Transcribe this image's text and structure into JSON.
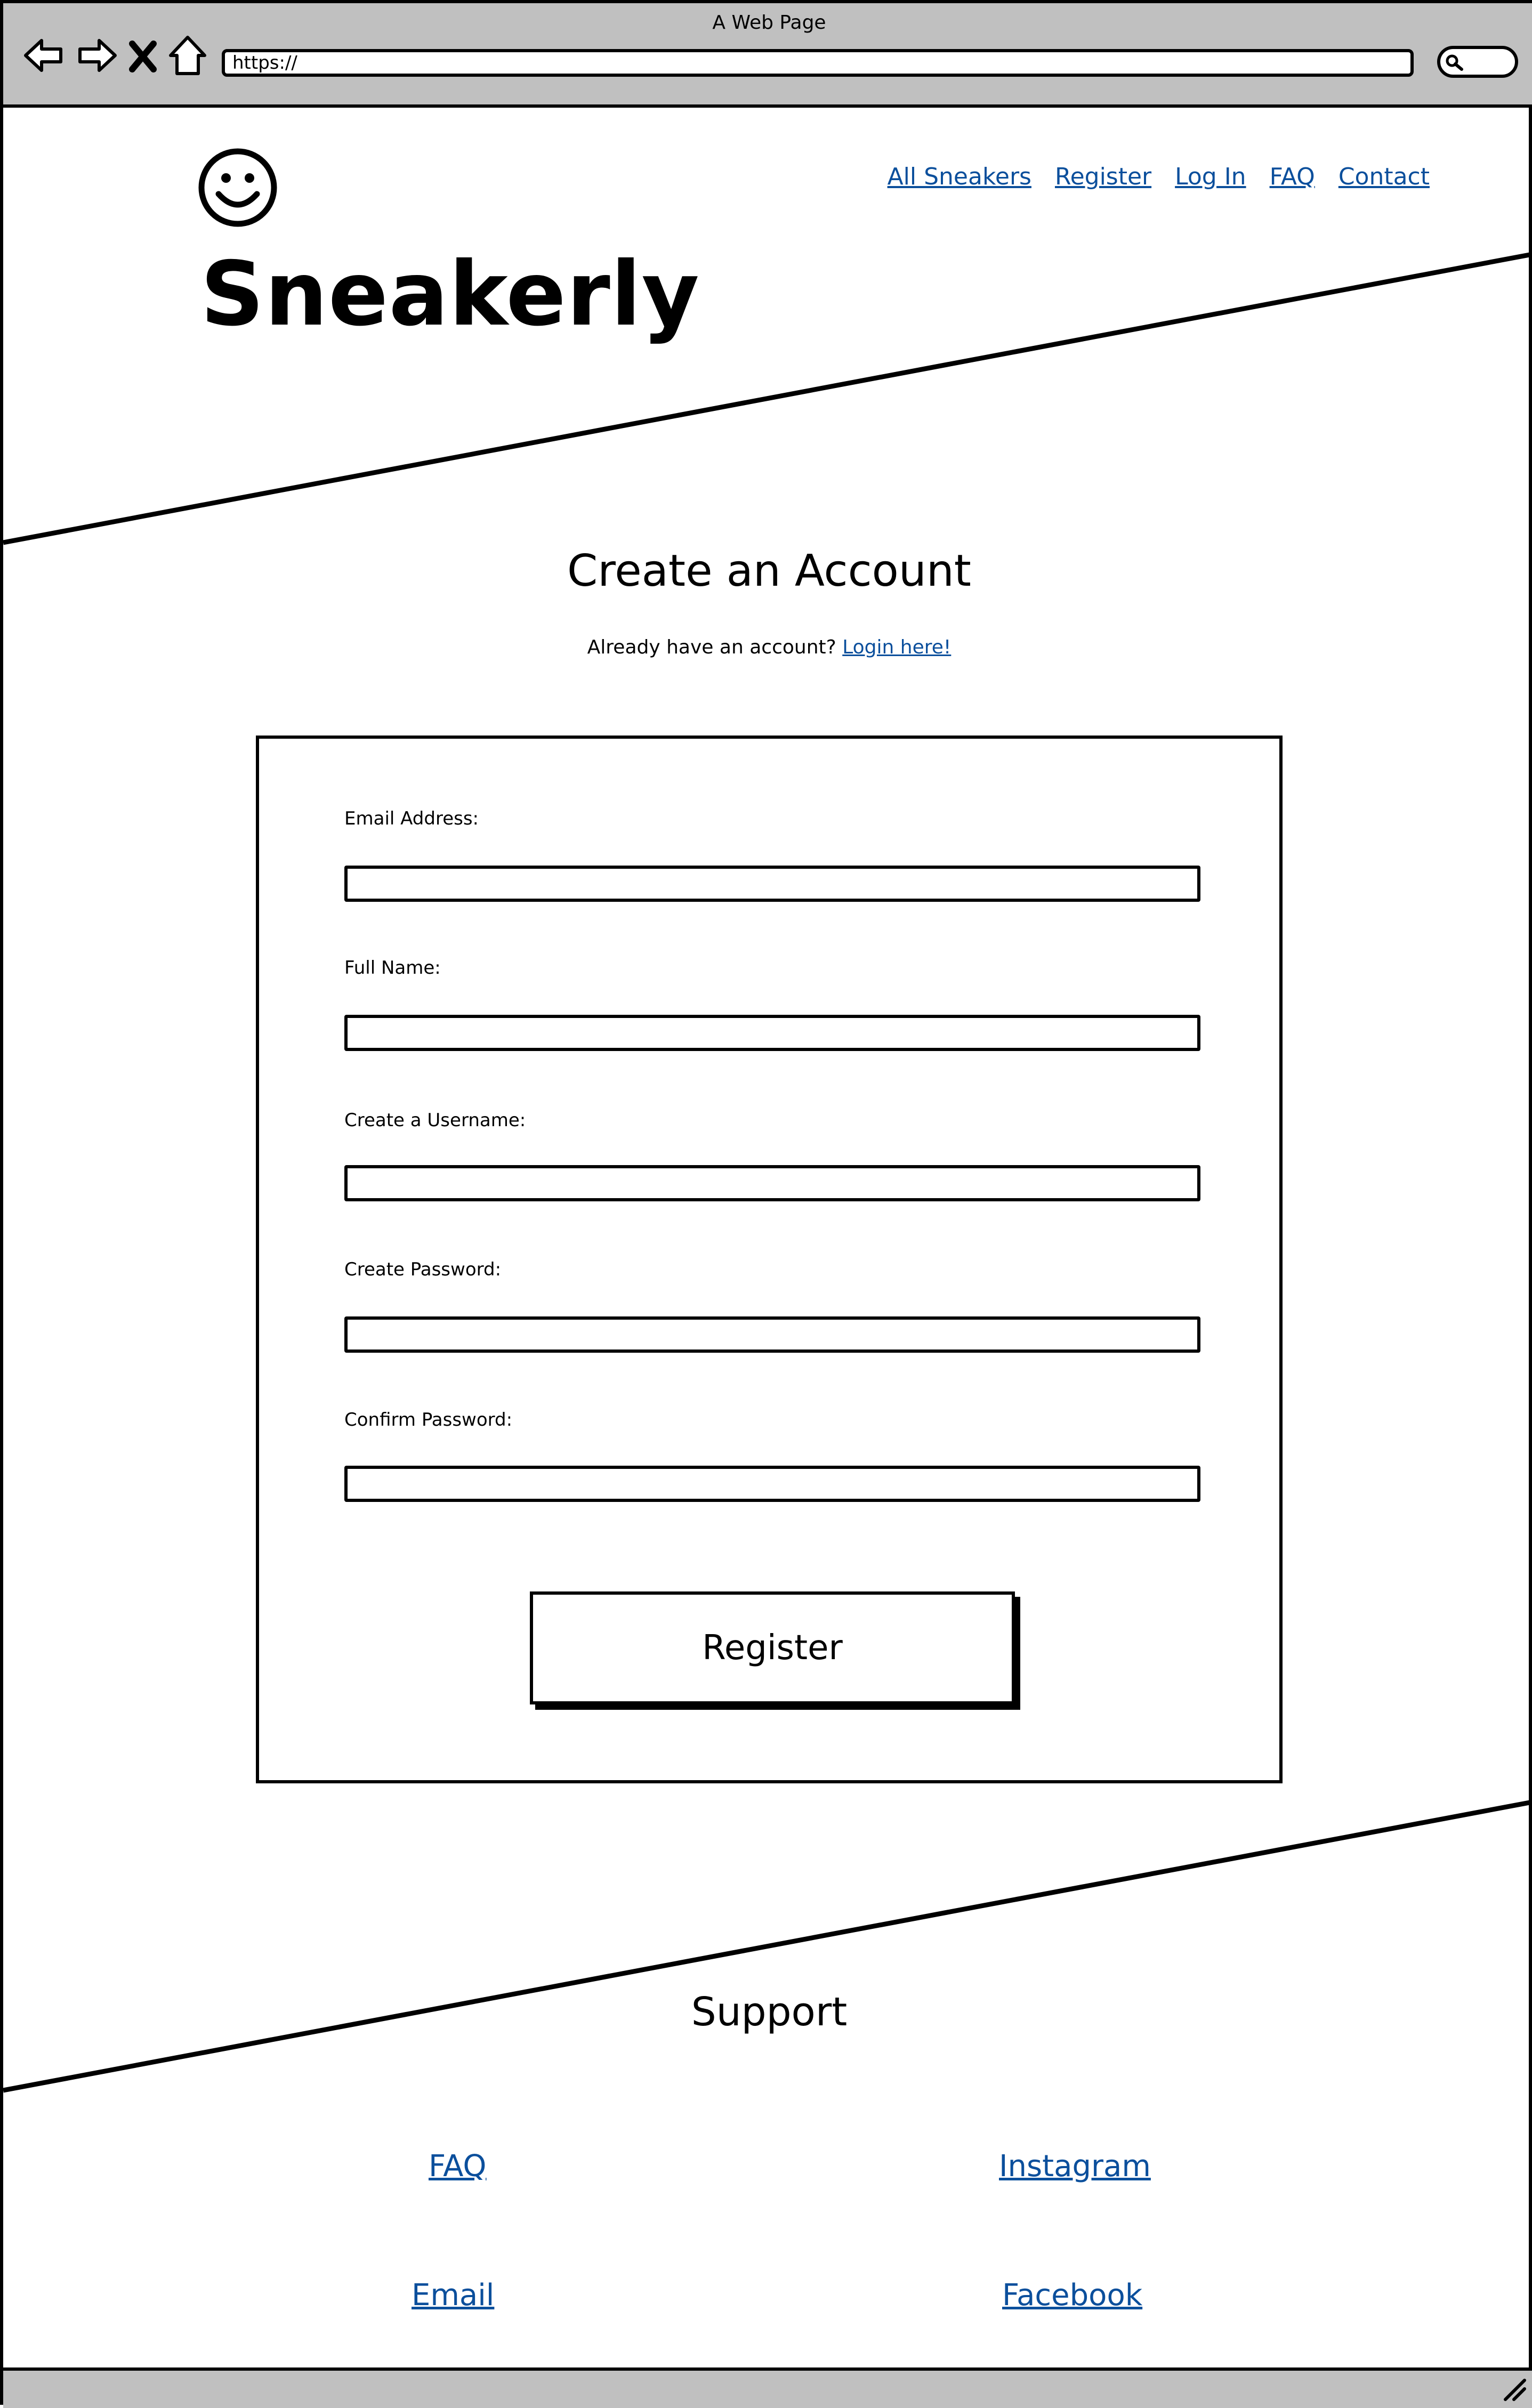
{
  "browser": {
    "window_title": "A Web Page",
    "url": "https://",
    "icons": [
      "back-arrow-icon",
      "forward-arrow-icon",
      "close-x-icon",
      "home-icon",
      "search-icon"
    ]
  },
  "header": {
    "logo_icon": "smiley-face-icon",
    "brand": "Sneakerly",
    "nav": [
      "All Sneakers",
      "Register",
      "Log In",
      "FAQ",
      "Contact"
    ]
  },
  "main": {
    "title": "Create an Account",
    "subtitle_text": "Already have an account?",
    "login_link": "Login here!",
    "fields": [
      {
        "label": "Email Address:",
        "value": ""
      },
      {
        "label": "Full Name:",
        "value": ""
      },
      {
        "label": "Create a Username:",
        "value": ""
      },
      {
        "label": "Create Password:",
        "value": ""
      },
      {
        "label": "Confirm Password:",
        "value": ""
      }
    ],
    "submit_label": "Register"
  },
  "footer": {
    "title": "Support",
    "links": [
      "FAQ",
      "Instagram",
      "Email",
      "Facebook"
    ]
  },
  "colors": {
    "link": "#0b4f9c",
    "chrome": "#c0c0c0",
    "stroke": "#000000"
  }
}
